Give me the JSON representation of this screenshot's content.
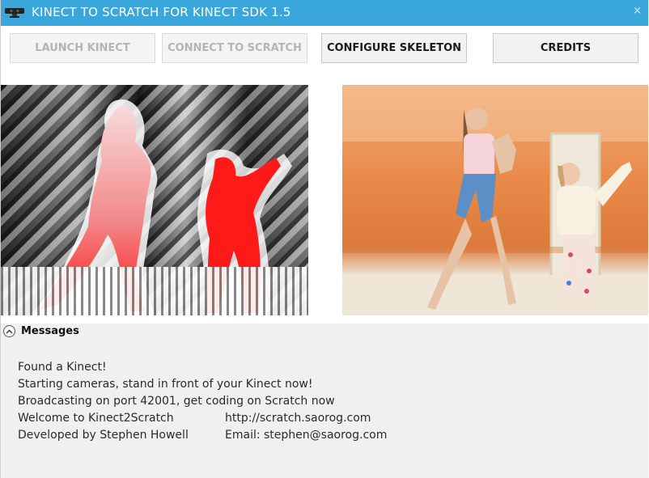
{
  "window": {
    "title": "KINECT TO SCRATCH FOR KINECT SDK 1.5",
    "close_glyph": "×",
    "accent_color": "#3aa7dc"
  },
  "toolbar": {
    "buttons": [
      {
        "label": "LAUNCH KINECT",
        "enabled": false
      },
      {
        "label": "CONNECT TO SCRATCH",
        "enabled": false
      },
      {
        "label": "CONFIGURE SKELETON",
        "enabled": true
      },
      {
        "label": "CREDITS",
        "enabled": true
      }
    ]
  },
  "views": {
    "depth": {
      "icon": "depth-camera-view"
    },
    "color": {
      "icon": "color-camera-view"
    }
  },
  "messages": {
    "title": "Messages",
    "lines": [
      "Found a Kinect!",
      "Starting cameras, stand in front of your Kinect now!",
      "Broadcasting on port 42001, get coding on Scratch now"
    ],
    "info_rows": [
      {
        "label": "Welcome to Kinect2Scratch",
        "value": "http://scratch.saorog.com"
      },
      {
        "label": "Developed by Stephen Howell",
        "value": "Email: stephen@saorog.com"
      }
    ]
  }
}
